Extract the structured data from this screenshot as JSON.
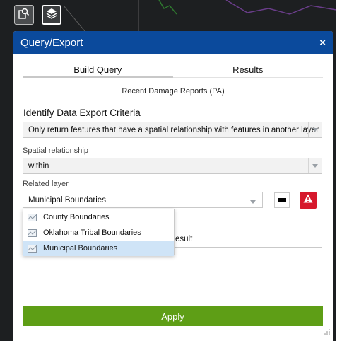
{
  "toolbar": {
    "query_icon": "search-document-icon",
    "layers_icon": "layers-icon"
  },
  "panel": {
    "title": "Query/Export",
    "close_label": "×",
    "tabs": [
      {
        "label": "Build Query",
        "active": true
      },
      {
        "label": "Results",
        "active": false
      }
    ],
    "layer_name": "Recent Damage Reports (PA)",
    "criteria_title": "Identify Data Export Criteria",
    "criteria_select": {
      "value": "Only return features that have a spatial relationship with features in another layer"
    },
    "spatial_relationship": {
      "label": "Spatial relationship",
      "value": "within"
    },
    "related_layer": {
      "label": "Related layer",
      "value": "Municipal Boundaries",
      "options": [
        {
          "label": "County Boundaries",
          "selected": false
        },
        {
          "label": "Oklahoma Tribal Boundaries",
          "selected": false
        },
        {
          "label": "Municipal Boundaries",
          "selected": true
        }
      ]
    },
    "result_field": {
      "visible_text": "esult"
    },
    "apply_label": "Apply"
  },
  "colors": {
    "header": "#0b4a9c",
    "apply": "#5e9e16",
    "warning": "#d6182c",
    "map": "#1d1f21",
    "selected_option": "#cfe4f7"
  }
}
